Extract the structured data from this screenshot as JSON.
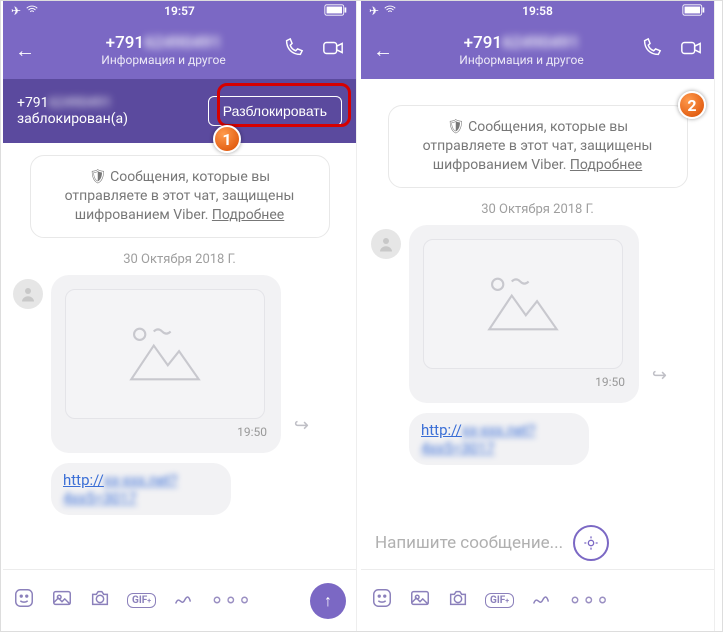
{
  "left": {
    "status": {
      "time": "19:57"
    },
    "header": {
      "contact_prefix": "+791",
      "contact_blur": "62490491",
      "subtitle": "Информация и другое"
    },
    "banner": {
      "num_prefix": "+791",
      "num_blur": "62490491",
      "status_line": "заблокирован(а)",
      "button": "Разблокировать"
    },
    "encryption": {
      "line1": "Сообщения, которые вы",
      "line2": "отправляете в этот чат, защищены",
      "line3_a": "шифрованием Viber. ",
      "more": "Подробнее"
    },
    "date": "30 Октября 2018 Г.",
    "msg_time": "19:50",
    "link_prefix": "http://",
    "link_blur": "xx-xxx.net?4xx5=3017",
    "callout": "1"
  },
  "right": {
    "status": {
      "time": "19:58"
    },
    "header": {
      "contact_prefix": "+791",
      "contact_blur": "62490491",
      "subtitle": "Информация и другое"
    },
    "encryption": {
      "line1": "Сообщения, которые вы",
      "line2": "отправляете в этот чат, защищены",
      "line3_a": "шифрованием Viber. ",
      "more": "Подробнее"
    },
    "date": "30 Октября 2018 Г.",
    "msg_time": "19:50",
    "link_prefix": "http://",
    "link_blur": "xx-xxx.net?4xx5=3017",
    "composer_placeholder": "Напишите сообщение...",
    "callout": "2"
  }
}
